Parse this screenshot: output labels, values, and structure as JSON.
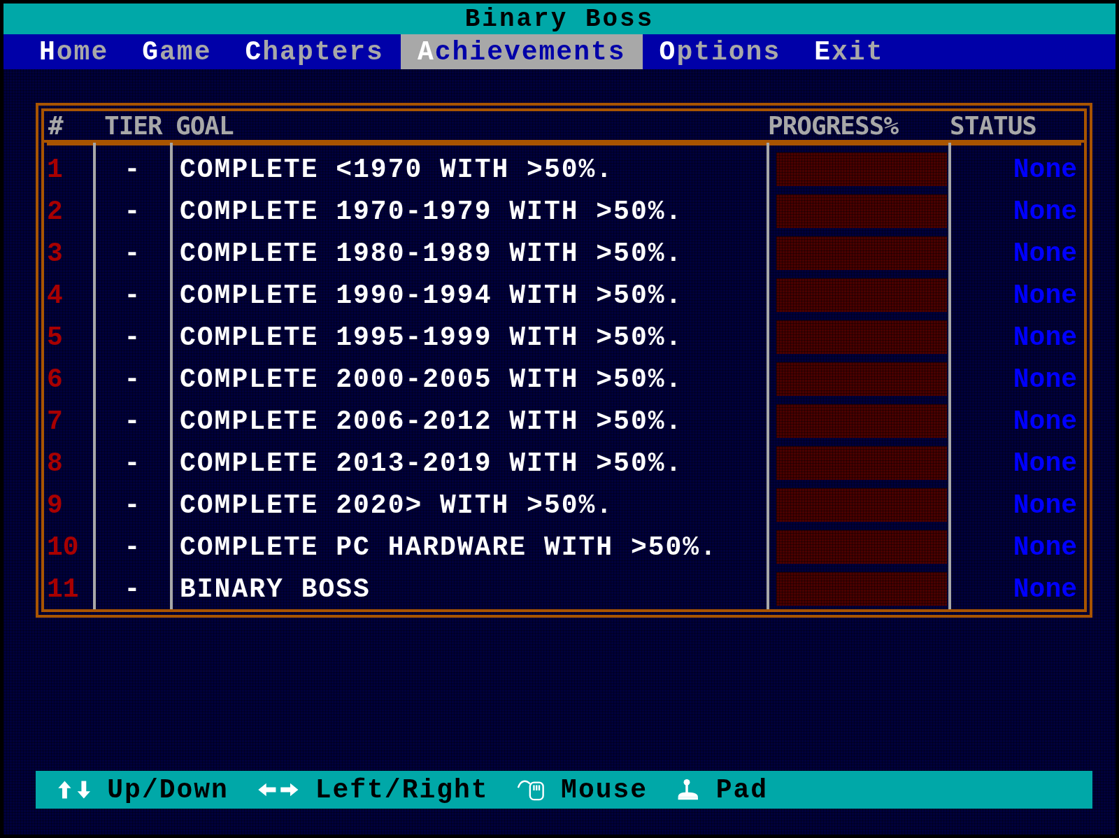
{
  "window": {
    "title": "Binary Boss"
  },
  "menu": [
    {
      "label": "Home",
      "selected": false
    },
    {
      "label": "Game",
      "selected": false
    },
    {
      "label": "Chapters",
      "selected": false
    },
    {
      "label": "Achievements",
      "selected": true
    },
    {
      "label": "Options",
      "selected": false
    },
    {
      "label": "Exit",
      "selected": false
    }
  ],
  "table": {
    "columns": [
      "#",
      "TIER",
      "GOAL",
      "PROGRESS%",
      "STATUS"
    ],
    "rows": [
      {
        "number": "1",
        "tier": "-",
        "goal": "COMPLETE <1970 WITH >50%.",
        "level": 0,
        "status": "None"
      },
      {
        "number": "2",
        "tier": "-",
        "goal": "COMPLETE 1970-1979 WITH >50%.",
        "level": 0,
        "status": "None"
      },
      {
        "number": "3",
        "tier": "-",
        "goal": "COMPLETE 1980-1989 WITH >50%.",
        "level": 0,
        "status": "None"
      },
      {
        "number": "4",
        "tier": "-",
        "goal": "COMPLETE 1990-1994 WITH >50%.",
        "level": 0,
        "status": "None"
      },
      {
        "number": "5",
        "tier": "-",
        "goal": "COMPLETE 1995-1999 WITH >50%.",
        "level": 0,
        "status": "None"
      },
      {
        "number": "6",
        "tier": "-",
        "goal": "COMPLETE 2000-2005 WITH >50%.",
        "level": 0,
        "status": "None"
      },
      {
        "number": "7",
        "tier": "-",
        "goal": "COMPLETE 2006-2012 WITH >50%.",
        "level": 0,
        "status": "None"
      },
      {
        "number": "8",
        "tier": "-",
        "goal": "COMPLETE 2013-2019 WITH >50%.",
        "level": 0,
        "status": "None"
      },
      {
        "number": "9",
        "tier": "-",
        "goal": "COMPLETE 2020> WITH >50%.",
        "level": 0,
        "status": "None"
      },
      {
        "number": "10",
        "tier": "-",
        "goal": "COMPLETE PC HARDWARE WITH >50%.",
        "level": 0,
        "status": "None"
      },
      {
        "number": "11",
        "tier": "-",
        "goal": "BINARY BOSS",
        "level": 0,
        "status": "None"
      }
    ]
  },
  "status_bar": [
    {
      "kind": "updown",
      "label": "Up/Down"
    },
    {
      "kind": "leftright",
      "label": "Left/Right"
    },
    {
      "kind": "mouse",
      "label": "Mouse"
    },
    {
      "kind": "pad",
      "label": "Pad"
    }
  ]
}
